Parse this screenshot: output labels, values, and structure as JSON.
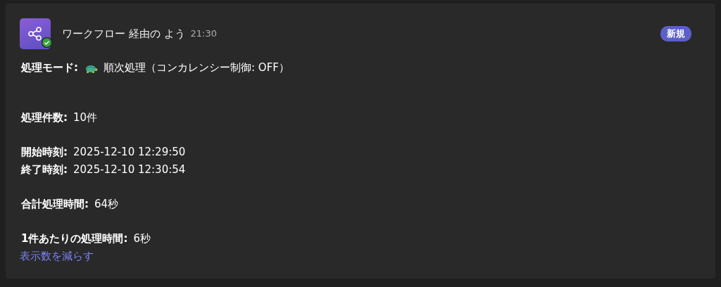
{
  "message": {
    "sender": "ワークフロー 経由の よう",
    "time": "21:30",
    "badge": "新規",
    "sections": [
      [
        {
          "label": "処理モード:",
          "value": "順次処理（コンカレンシー制御: OFF）",
          "kind": "mode"
        }
      ],
      [
        {
          "label": "処理件数:",
          "value": "10件",
          "kind": "plain"
        }
      ],
      [
        {
          "label": "開始時刻:",
          "value": "2025-12-10 12:29:50",
          "kind": "plain"
        },
        {
          "label": "終了時刻:",
          "value": "2025-12-10 12:30:54",
          "kind": "plain"
        }
      ],
      [
        {
          "label": "合計処理時間:",
          "value": "64秒",
          "kind": "plain"
        }
      ],
      [
        {
          "label": "1件あたりの処理時間:",
          "value": "6秒",
          "kind": "plain"
        }
      ]
    ],
    "link": "表示数を減らす"
  }
}
